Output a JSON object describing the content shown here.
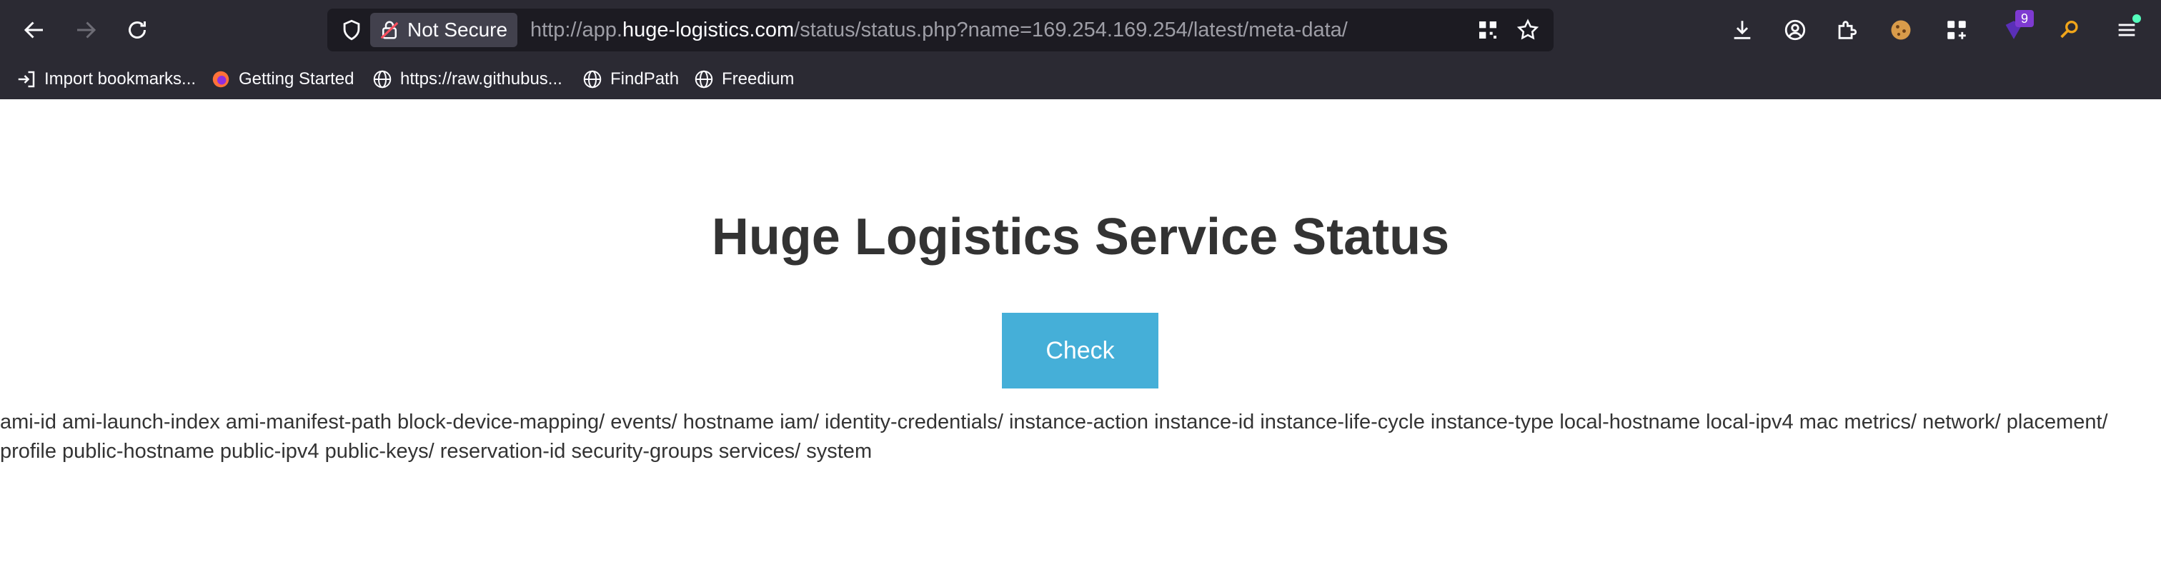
{
  "browser": {
    "security_label": "Not Secure",
    "url_prefix": "http://app.",
    "url_host": "huge-logistics.com",
    "url_path": "/status/status.php?name=169.254.169.254/latest/meta-data/",
    "extension_badge": "9",
    "bookmarks": [
      {
        "label": "Import bookmarks...",
        "icon": "import-icon"
      },
      {
        "label": "Getting Started",
        "icon": "firefox-icon"
      },
      {
        "label": "https://raw.githubus...",
        "icon": "globe-icon"
      },
      {
        "label": "FindPath",
        "icon": "globe-icon"
      },
      {
        "label": "Freedium",
        "icon": "globe-icon"
      }
    ]
  },
  "page": {
    "title": "Huge Logistics Service Status",
    "check_label": "Check",
    "result_text": "ami-id ami-launch-index ami-manifest-path block-device-mapping/ events/ hostname iam/ identity-credentials/ instance-action instance-id instance-life-cycle instance-type local-hostname local-ipv4 mac metrics/ network/ placement/ profile public-hostname public-ipv4 public-keys/ reservation-id security-groups services/ system"
  },
  "colors": {
    "chrome_bg": "#2b2a33",
    "urlbar_bg": "#1c1b22",
    "button_bg": "#45afd8",
    "title_color": "#333333"
  }
}
